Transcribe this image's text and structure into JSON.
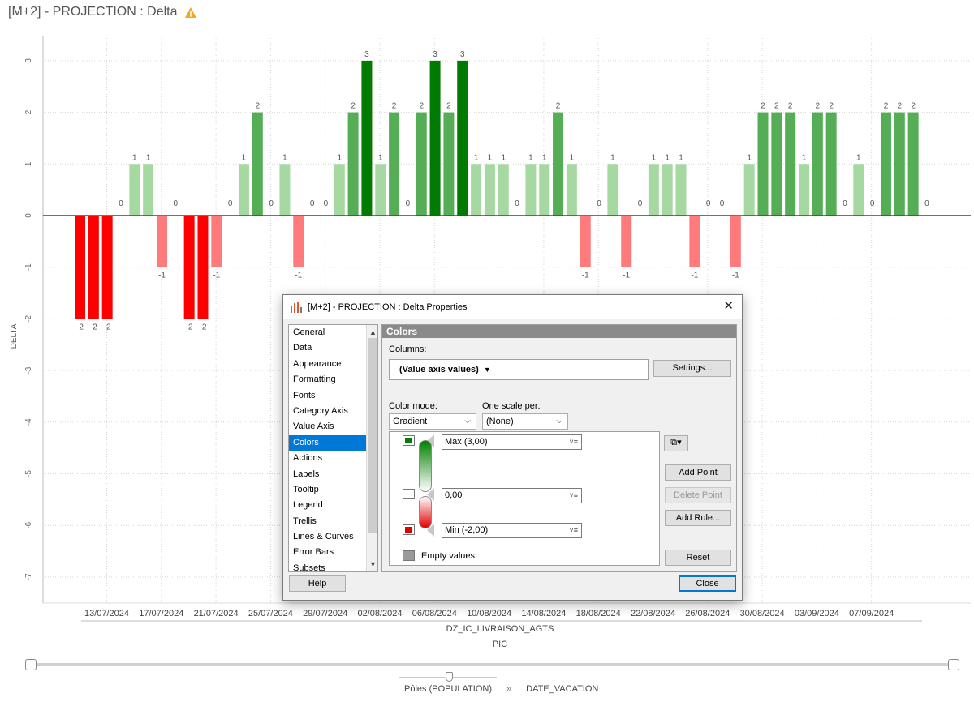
{
  "visualization": {
    "title": "[M+2] - PROJECTION : Delta",
    "warning_icon": "warning-triangle-icon",
    "warning_color": "#f5a623"
  },
  "chart_data": {
    "type": "bar",
    "ylabel": "DELTA",
    "xlabel": "DZ_IC_LIVRAISON_AGTS",
    "xlabel2": "PIC",
    "ylim": [
      -7.5,
      3.4
    ],
    "y_ticks": [
      3,
      2,
      1,
      0,
      -1,
      -2,
      -3,
      -4,
      -5,
      -6,
      -7
    ],
    "x_tick_labels": [
      "13/07/2024",
      "17/07/2024",
      "21/07/2024",
      "25/07/2024",
      "29/07/2024",
      "02/08/2024",
      "06/08/2024",
      "10/08/2024",
      "14/08/2024",
      "18/08/2024",
      "22/08/2024",
      "26/08/2024",
      "30/08/2024",
      "03/09/2024",
      "07/09/2024"
    ],
    "values": [
      -2,
      -2,
      -2,
      0,
      1,
      1,
      -1,
      0,
      -2,
      -2,
      -1,
      0,
      1,
      2,
      0,
      1,
      -1,
      0,
      0,
      1,
      2,
      3,
      1,
      2,
      0,
      2,
      3,
      2,
      3,
      1,
      1,
      1,
      0,
      1,
      1,
      2,
      1,
      -1,
      0,
      1,
      -1,
      0,
      1,
      1,
      1,
      -1,
      0,
      0,
      -1,
      1,
      2,
      2,
      2,
      1,
      2,
      2,
      0,
      1,
      0,
      2,
      2,
      2,
      0
    ],
    "grid": true,
    "legend": "none",
    "color_max": "#007a00",
    "color_mid": "#ffffff",
    "color_min": "#ff0000"
  },
  "hierarchy": {
    "level1": "Pôles (POPULATION)",
    "separator": "»",
    "level2": "DATE_VACATION"
  },
  "dialog": {
    "title": "[M+2] - PROJECTION : Delta Properties",
    "nav_items": [
      "General",
      "Data",
      "Appearance",
      "Formatting",
      "Fonts",
      "Category Axis",
      "Value Axis",
      "Colors",
      "Actions",
      "Labels",
      "Tooltip",
      "Legend",
      "Trellis",
      "Lines & Curves",
      "Error Bars",
      "Subsets"
    ],
    "selected_nav": "Colors",
    "panel_title": "Colors",
    "columns_label": "Columns:",
    "columns_value": "(Value axis values)",
    "settings_button": "Settings...",
    "color_mode_label": "Color mode:",
    "color_mode_value": "Gradient",
    "one_scale_label": "One scale per:",
    "one_scale_value": "(None)",
    "stops": [
      {
        "label": "Max (3,00)",
        "color": "#008000"
      },
      {
        "label": "0,00",
        "color": "#ffffff"
      },
      {
        "label": "Min (-2,00)",
        "color": "#e00000"
      }
    ],
    "empty_values_label": "Empty values",
    "empty_values_color": "#9a9a9a",
    "add_point": "Add Point",
    "delete_point": "Delete Point",
    "add_rule": "Add Rule...",
    "reset": "Reset",
    "help": "Help",
    "close": "Close"
  }
}
